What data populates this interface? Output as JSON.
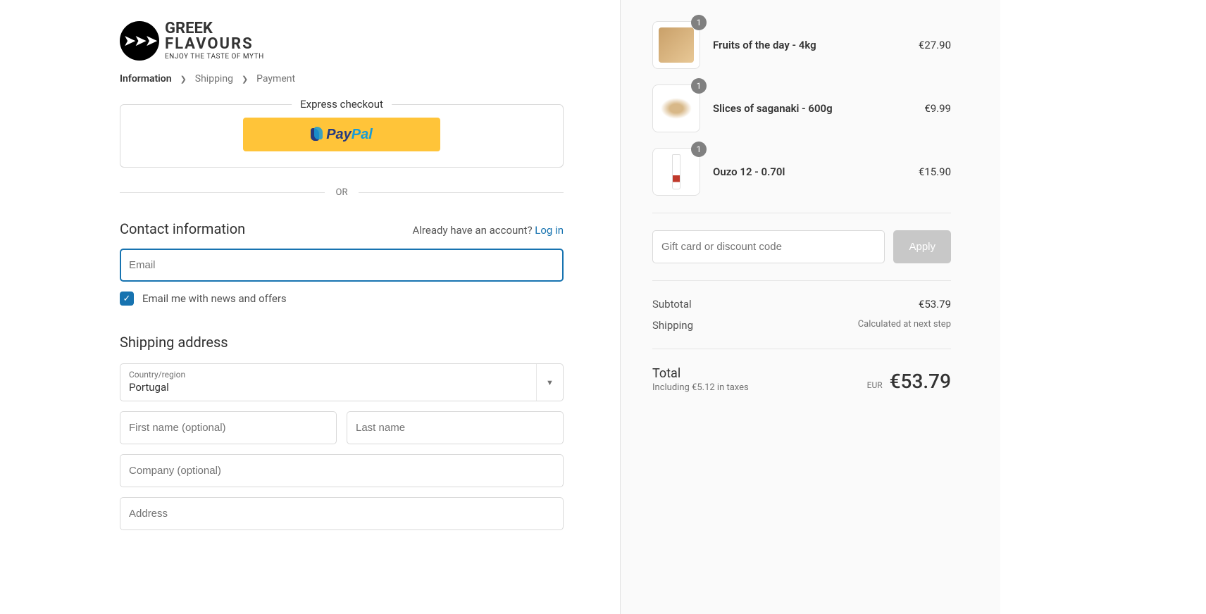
{
  "logo": {
    "line1": "GREEK",
    "line2": "FLAVOURS",
    "tagline": "ENJOY THE TASTE OF MYTH"
  },
  "breadcrumb": {
    "step1": "Information",
    "step2": "Shipping",
    "step3": "Payment"
  },
  "express": {
    "title": "Express checkout",
    "paypal_pay": "Pay",
    "paypal_pal": "Pal"
  },
  "divider_or": "OR",
  "contact": {
    "title": "Contact information",
    "prompt": "Already have an account? ",
    "login": "Log in",
    "email_placeholder": "Email",
    "news_checkbox": "Email me with news and offers"
  },
  "shipping": {
    "title": "Shipping address",
    "country_label": "Country/region",
    "country_value": "Portugal",
    "first_name_placeholder": "First name (optional)",
    "last_name_placeholder": "Last name",
    "company_placeholder": "Company (optional)",
    "address_placeholder": "Address"
  },
  "cart": {
    "items": [
      {
        "name": "Fruits of the day - 4kg",
        "qty": "1",
        "price": "€27.90",
        "thumb_bg": "linear-gradient(135deg,#d4a574,#f0c896)"
      },
      {
        "name": "Slices of saganaki - 600g",
        "qty": "1",
        "price": "€9.99",
        "thumb_bg": "radial-gradient(circle,#e8c89a,#fff)"
      },
      {
        "name": "Ouzo 12 - 0.70l",
        "qty": "1",
        "price": "€15.90",
        "thumb_bg": "linear-gradient(#fff,#fff)"
      }
    ],
    "discount_placeholder": "Gift card or discount code",
    "apply_label": "Apply",
    "subtotal_label": "Subtotal",
    "subtotal_value": "€53.79",
    "shipping_label": "Shipping",
    "shipping_value": "Calculated at next step",
    "total_label": "Total",
    "tax_note": "Including €5.12 in taxes",
    "currency": "EUR",
    "total_value": "€53.79"
  }
}
